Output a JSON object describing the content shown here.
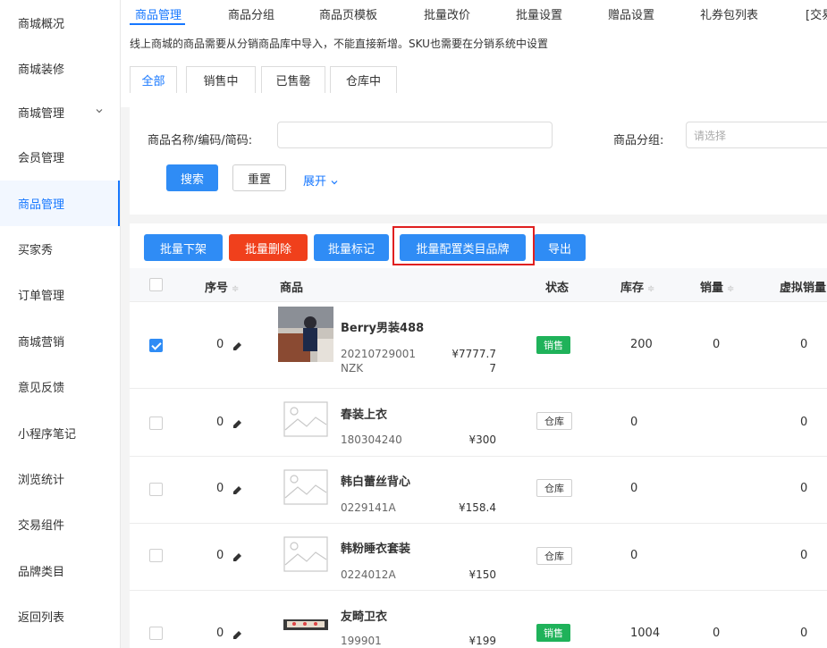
{
  "sidebar": {
    "items": [
      {
        "label": "商城概况"
      },
      {
        "label": "商城装修"
      },
      {
        "label": "商城管理"
      },
      {
        "label": "会员管理"
      },
      {
        "label": "商品管理"
      },
      {
        "label": "买家秀"
      },
      {
        "label": "订单管理"
      },
      {
        "label": "商城营销"
      },
      {
        "label": "意见反馈"
      },
      {
        "label": "小程序笔记"
      },
      {
        "label": "浏览统计"
      },
      {
        "label": "交易组件"
      },
      {
        "label": "品牌类目"
      },
      {
        "label": "返回列表"
      }
    ],
    "active": "商品管理"
  },
  "tabs": [
    "商品管理",
    "商品分组",
    "商品页模板",
    "批量改价",
    "批量设置",
    "赠品设置",
    "礼券包列表",
    "[交易"
  ],
  "notice": "线上商城的商品需要从分销商品库中导入，不能直接新增。SKU也需要在分销系统中设置",
  "subtabs": [
    "全部",
    "销售中",
    "已售罄",
    "仓库中"
  ],
  "filter": {
    "name_label": "商品名称/编码/简码:",
    "group_label": "商品分组:",
    "group_placeholder": "请选择",
    "search": "搜索",
    "reset": "重置",
    "expand": "展开"
  },
  "actions": {
    "offshelf": "批量下架",
    "delete": "批量删除",
    "mark": "批量标记",
    "brand": "批量配置类目品牌",
    "export": "导出"
  },
  "table": {
    "headers": {
      "seq": "序号",
      "product": "商品",
      "status": "状态",
      "stock": "库存",
      "sales": "销量",
      "vsales": "虚拟销量"
    },
    "sort_glyph": "≑",
    "rows": [
      {
        "seq": "0",
        "name": "Berry男装488",
        "code": "20210729001",
        "code2": "NZK",
        "price": "¥7777.7",
        "price2": "7",
        "status": "销售",
        "stock": "200",
        "sales": "0",
        "vsales": "0",
        "checked": true
      },
      {
        "seq": "0",
        "name": "春装上衣",
        "code": "180304240",
        "price": "¥300",
        "status": "仓库",
        "stock": "0",
        "sales": "",
        "vsales": "0"
      },
      {
        "seq": "0",
        "name": "韩白蕾丝背心",
        "code": "0229141A",
        "price": "¥158.4",
        "status": "仓库",
        "stock": "0",
        "sales": "",
        "vsales": "0"
      },
      {
        "seq": "0",
        "name": "韩粉睡衣套装",
        "code": "0224012A",
        "price": "¥150",
        "status": "仓库",
        "stock": "0",
        "sales": "",
        "vsales": "0"
      },
      {
        "seq": "0",
        "name": "友畸卫衣",
        "code": "199901",
        "price": "¥199",
        "status": "销售",
        "stock": "1004",
        "sales": "0",
        "vsales": "0"
      }
    ]
  },
  "colors": {
    "accent": "#1677ff",
    "danger": "#f0401c",
    "success": "#1fb25a",
    "highlight": "#e02020"
  }
}
